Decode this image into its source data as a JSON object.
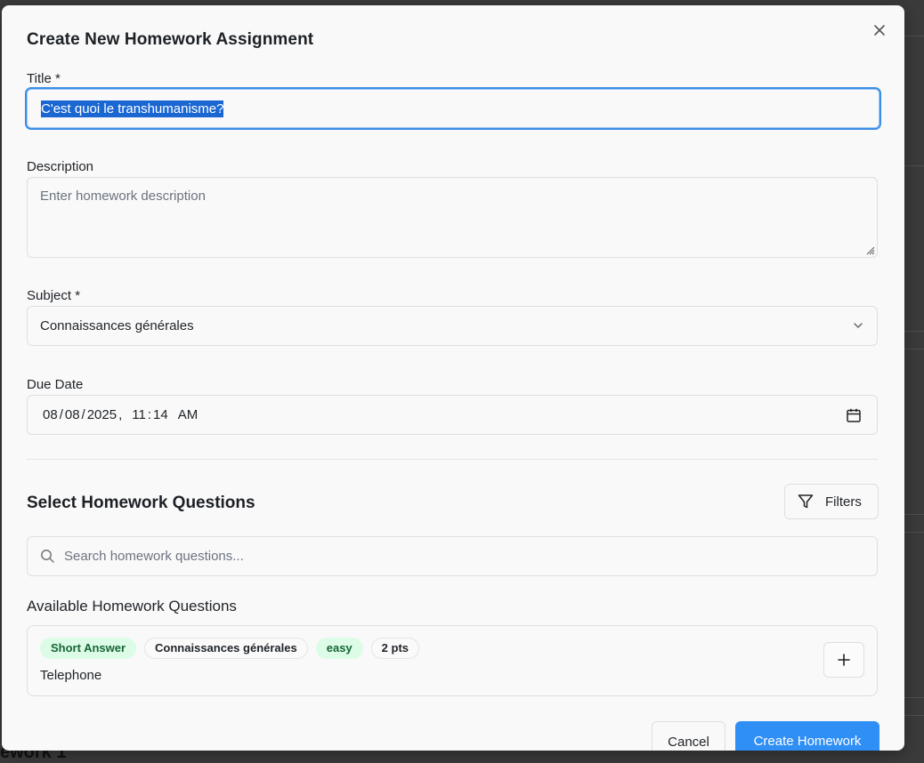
{
  "modal": {
    "title": "Create New Homework Assignment",
    "close_icon": "close-icon"
  },
  "form": {
    "title_label": "Title *",
    "title_value": "C'est quoi le transhumanisme?",
    "description_label": "Description",
    "description_placeholder": "Enter homework description",
    "subject_label": "Subject *",
    "subject_value": "Connaissances générales",
    "due_date_label": "Due Date",
    "due_date": {
      "month": "08",
      "day": "08",
      "year": "2025",
      "hour": "11",
      "minute": "14",
      "ampm": "AM"
    }
  },
  "questions_section": {
    "title": "Select Homework Questions",
    "filters_label": "Filters",
    "search_placeholder": "Search homework questions...",
    "available_label": "Available Homework Questions",
    "items": [
      {
        "type": "Short Answer",
        "subject": "Connaissances générales",
        "difficulty": "easy",
        "points": "2 pts",
        "text": "Telephone"
      }
    ]
  },
  "footer": {
    "cancel_label": "Cancel",
    "create_label": "Create Homework"
  },
  "colors": {
    "accent": "#2f8ff5",
    "focus_border": "#3b8ee8",
    "badge_green_bg": "#dcfce7",
    "badge_green_text": "#166534"
  },
  "backdrop": {
    "partial_text": "ework 1"
  }
}
